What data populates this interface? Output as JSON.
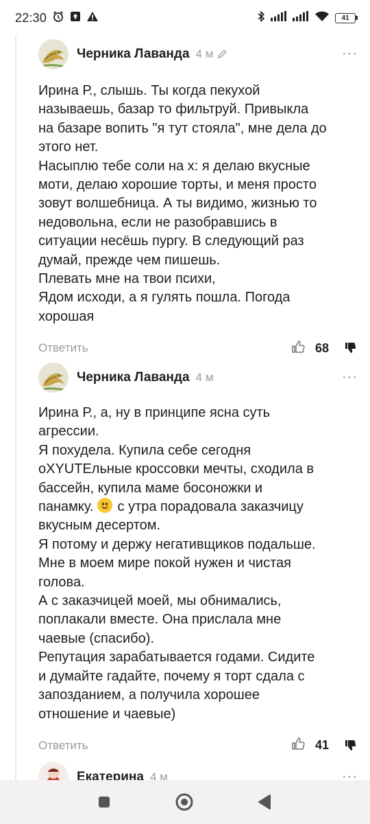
{
  "status_bar": {
    "time": "22:30",
    "battery": "41"
  },
  "comments": [
    {
      "author": "Черника Лаванда",
      "time": "4 м",
      "edited": true,
      "lines": [
        "Ирина Р., слышь. Ты когда пекухой",
        "называешь, базар то фильтруй. Привыкла",
        "на базаре вопить \"я тут стояла\", мне дела до",
        "этого нет.",
        "Насыплю тебе соли на х: я делаю вкусные",
        "моти, делаю хорошие торты, и меня просто",
        "зовут волшебница. А ты видимо, жизнью то",
        "недовольна, если не разобравшись в",
        "ситуации несёшь пургу. В следующий раз",
        "думай, прежде чем пишешь.",
        "Плевать мне на твои психи,",
        "Ядом исходи, а я гулять пошла. Погода",
        "хорошая"
      ],
      "reply_label": "Ответить",
      "likes": "68"
    },
    {
      "author": "Черника Лаванда",
      "time": "4 м",
      "edited": false,
      "lines": [
        "Ирина Р., а, ну в принципе ясна суть",
        "агрессии.",
        "Я похудела. Купила себе сегодня",
        "оXYUTEльные кроссовки мечты, сходила в",
        "бассейн, купила маме босоножки и",
        "панамку.",
        "вкусным десертом.",
        "Я потому и держу негативщиков подальше.",
        "Мне в моем мире покой нужен и чистая",
        "голова.",
        "А с заказчицей моей, мы обнимались,",
        "поплакали вместе. Она прислала мне",
        "чаевые (спасибо).",
        "Репутация зарабатывается годами. Сидите",
        "и думайте гадайте, почему я торт сдала с",
        "запозданием, а получила хорошее",
        "отношение и чаевые)"
      ],
      "emoji_line_suffix": "с утра порадовала заказчицу",
      "reply_label": "Ответить",
      "likes": "41"
    },
    {
      "author": "Екатерина",
      "time": "4 м"
    }
  ]
}
